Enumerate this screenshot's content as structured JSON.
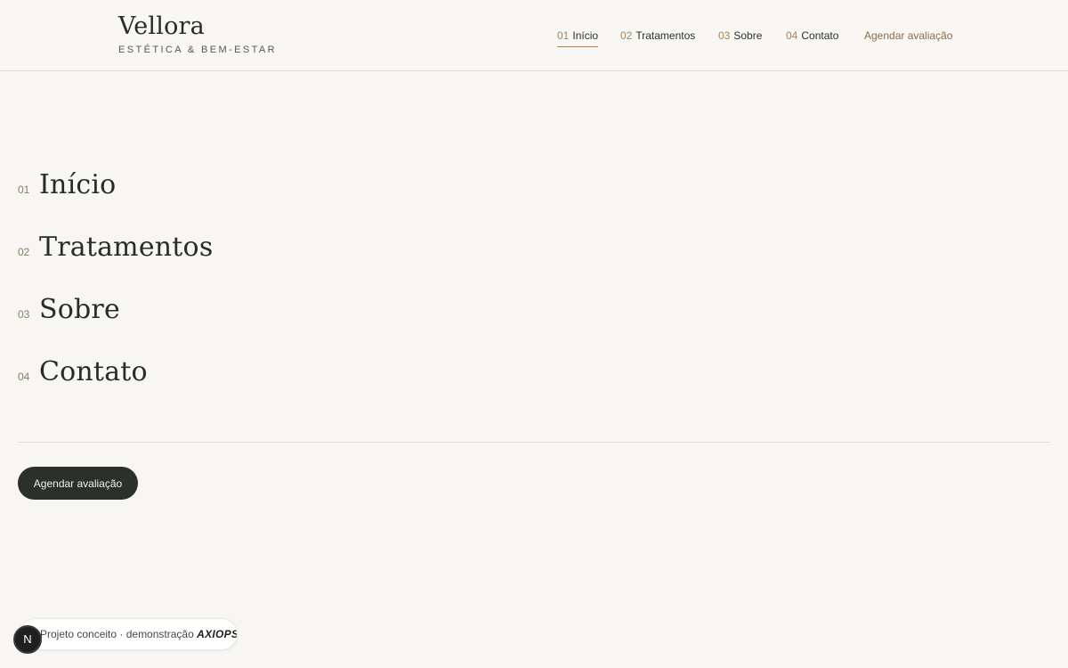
{
  "brand": {
    "name": "Vellora",
    "tagline": "ESTÉTICA & BEM-ESTAR"
  },
  "topnav": {
    "items": [
      {
        "num": "01",
        "label": "Início"
      },
      {
        "num": "02",
        "label": "Tratamentos"
      },
      {
        "num": "03",
        "label": "Sobre"
      },
      {
        "num": "04",
        "label": "Contato"
      }
    ],
    "cta": "Agendar avaliação"
  },
  "menu": {
    "items": [
      {
        "num": "01",
        "label": "Início"
      },
      {
        "num": "02",
        "label": "Tratamentos"
      },
      {
        "num": "03",
        "label": "Sobre"
      },
      {
        "num": "04",
        "label": "Contato"
      }
    ],
    "cta": "Agendar avaliação"
  },
  "demo_pill": {
    "text": "Projeto conceito · demonstração",
    "brand": "AXIOPS."
  },
  "next_badge": {
    "letter": "N"
  },
  "colors": {
    "background": "#f8f6f2",
    "accent": "#a08466",
    "dark": "#2b302a"
  }
}
